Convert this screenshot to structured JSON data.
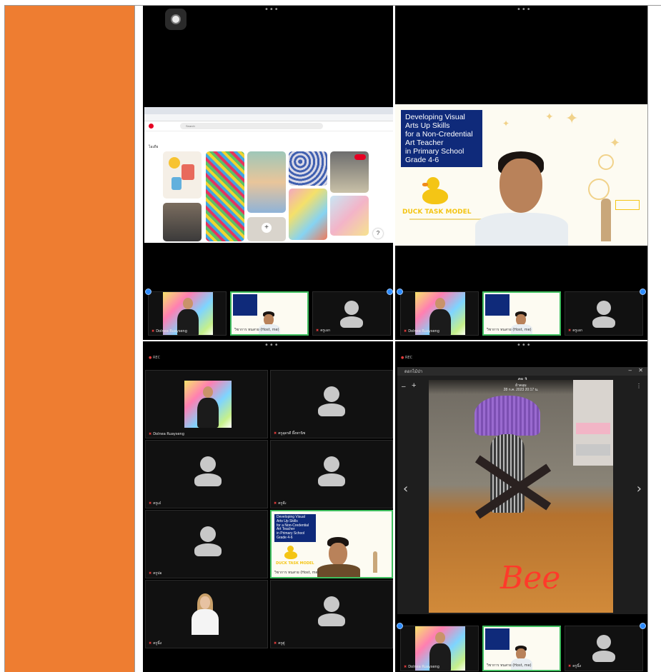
{
  "dots": "•••",
  "slide": {
    "title": "Developing Visual\nArts Up Skills\nfor a Non-Credential\nArt Teacher\nin Primary School\nGrade 4-6",
    "brand": "DUCK TASK MODEL"
  },
  "browser": {
    "search_placeholder": "Search",
    "results_label": "ไอเดีย"
  },
  "strip_top_left": [
    {
      "name": "Dolnea Ruayseng"
    },
    {
      "name": "วิชาการ ทนสาย (Host, me)"
    },
    {
      "name": "ครูเอก"
    }
  ],
  "strip_top_right": [
    {
      "name": "Dolnea Ruayseng"
    },
    {
      "name": "วิชาการ ทนสาย (Host, me)"
    },
    {
      "name": "ครูเอก"
    }
  ],
  "gallery": {
    "rec_label": "REC",
    "tiles": [
      {
        "name": "Dolnea Ruayseng"
      },
      {
        "name": "ครูอุดรดี ผึ้งพานิช"
      },
      {
        "name": "ครูเอ๋"
      },
      {
        "name": "ครูจ๊ะ"
      },
      {
        "name": "ครูปอ"
      },
      {
        "name": "วิชาการ ทนสาย (Host, me)"
      },
      {
        "name": "ครูนิ้ง"
      },
      {
        "name": "ครูตู่"
      }
    ]
  },
  "viewer": {
    "rec_label": "REC",
    "file_name": "ภม.3",
    "file_subtitle": "ผ้าคลุม",
    "date": "28 ก.ค. 2023 20:17 น.",
    "overlay_text": "Bee",
    "app_name": "ดอกไม้ป่า"
  },
  "strip_bottom": [
    {
      "name": "Dolnea Ruayseng"
    },
    {
      "name": "วิชาการ ทนสาย (Host, me)"
    },
    {
      "name": "ครูนิ้ง"
    }
  ],
  "colors": {
    "accent_orange": "#ee7d31",
    "slide_navy": "#0f2a7a",
    "active_speaker": "#3fbf5f",
    "zoom_blue": "#2d8cff"
  }
}
